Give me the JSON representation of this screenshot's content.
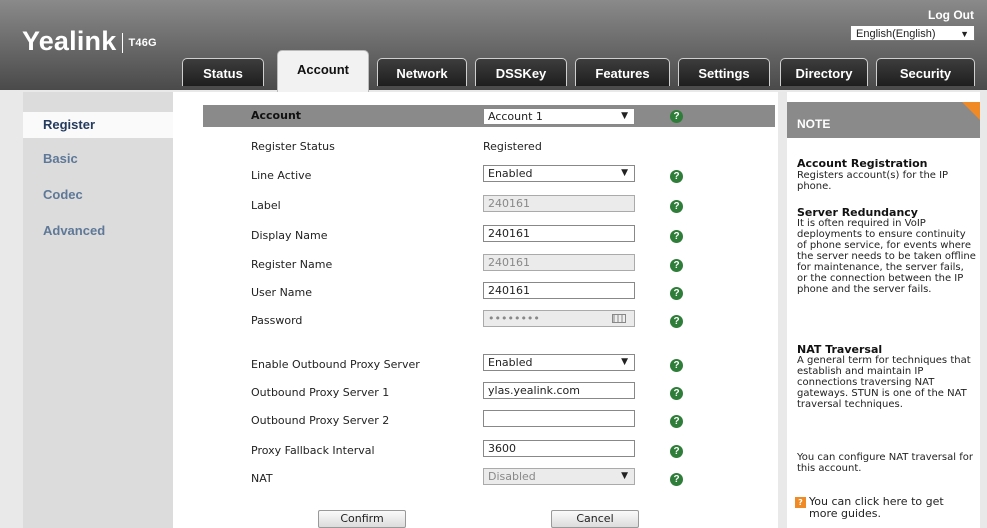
{
  "header": {
    "logo_brand": "Yealink",
    "logo_model": "T46G",
    "logout": "Log Out",
    "language": "English(English)"
  },
  "tabs": [
    "Status",
    "Account",
    "Network",
    "DSSKey",
    "Features",
    "Settings",
    "Directory",
    "Security"
  ],
  "sidebar": {
    "items": [
      {
        "label": "Register"
      },
      {
        "label": "Basic"
      },
      {
        "label": "Codec"
      },
      {
        "label": "Advanced"
      }
    ]
  },
  "form": {
    "account_label": "Account",
    "account_value": "Account 1",
    "register_status_label": "Register Status",
    "register_status_value": "Registered",
    "line_active_label": "Line Active",
    "line_active_value": "Enabled",
    "label_label": "Label",
    "label_value": "240161",
    "display_name_label": "Display Name",
    "display_name_value": "240161",
    "register_name_label": "Register Name",
    "register_name_value": "240161",
    "user_name_label": "User Name",
    "user_name_value": "240161",
    "password_label": "Password",
    "password_value": "••••••••",
    "outbound_proxy_label": "Enable Outbound Proxy Server",
    "outbound_proxy_value": "Enabled",
    "proxy1_label": "Outbound Proxy Server 1",
    "proxy1_value": "ylas.yealink.com",
    "proxy2_label": "Outbound Proxy Server 2",
    "proxy2_value": "",
    "fallback_label": "Proxy Fallback Interval",
    "fallback_value": "3600",
    "nat_label": "NAT",
    "nat_value": "Disabled",
    "confirm": "Confirm",
    "cancel": "Cancel",
    "help": "?"
  },
  "note": {
    "title": "NOTE",
    "s1_title": "Account Registration",
    "s1_text": "Registers account(s) for the IP phone.",
    "s2_title": "Server Redundancy",
    "s2_text": "It is often required in VoIP deployments to ensure continuity of phone service, for events where the server needs to be taken offline for maintenance, the server fails, or the connection between the IP phone and the server fails.",
    "s3_title": "NAT Traversal",
    "s3_text": "A general term for techniques that establish and maintain IP connections traversing NAT gateways. STUN is one of the NAT traversal techniques.",
    "s4_text": "You can configure NAT traversal for this account.",
    "guide_icon": "?",
    "guide_text": "You can click here to get more guides."
  },
  "colors": {
    "help_icon": "#2e7d38",
    "note_accent": "#f08a24",
    "sidebar_link": "#5e7898"
  }
}
